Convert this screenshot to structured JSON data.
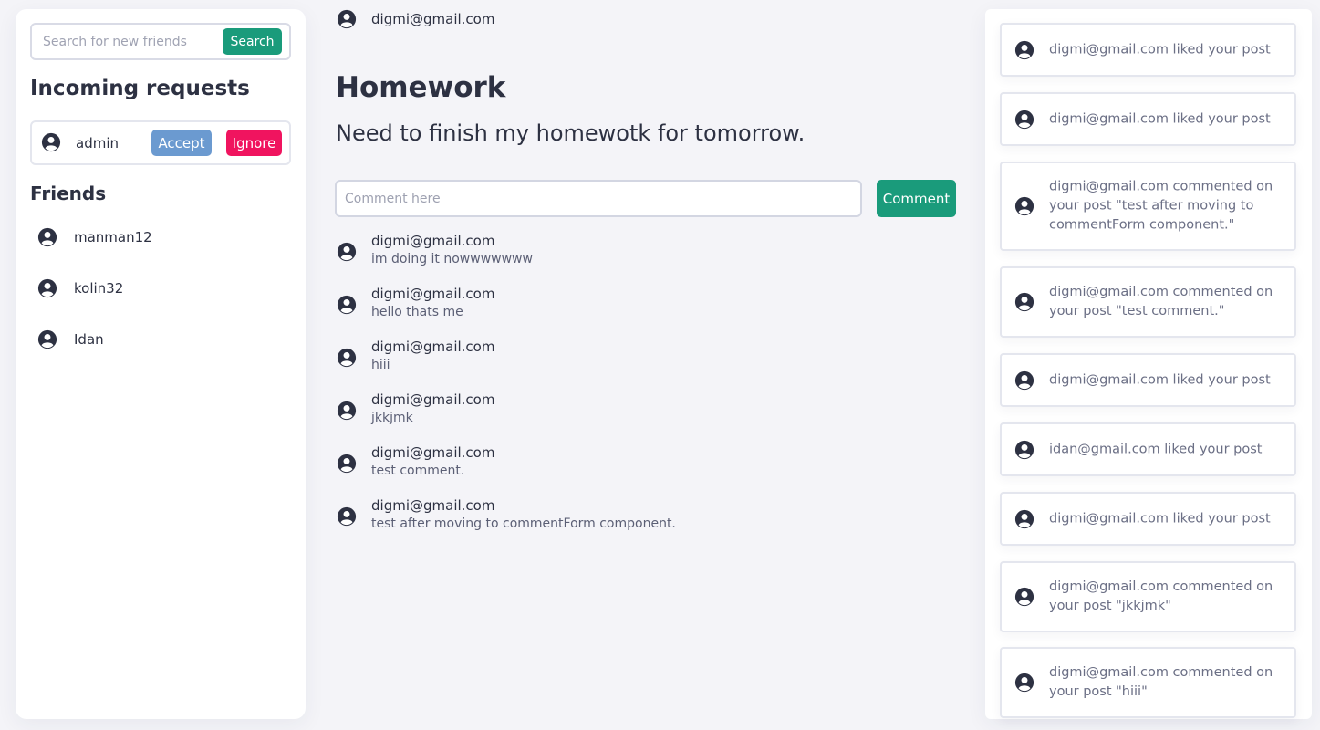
{
  "sidebar": {
    "search": {
      "placeholder": "Search for new friends",
      "button_label": "Search"
    },
    "incoming_title": "Incoming requests",
    "requests": [
      {
        "name": "admin",
        "accept_label": "Accept",
        "ignore_label": "Ignore"
      }
    ],
    "friends_title": "Friends",
    "friends": [
      {
        "name": "manman12"
      },
      {
        "name": "kolin32"
      },
      {
        "name": "Idan"
      }
    ]
  },
  "post": {
    "author": "digmi@gmail.com",
    "title": "Homework",
    "body": "Need to finish my homewotk for tomorrow.",
    "comment_placeholder": "Comment here",
    "comment_button_label": "Comment",
    "comments": [
      {
        "author": "digmi@gmail.com",
        "text": "im doing it nowwwwwww"
      },
      {
        "author": "digmi@gmail.com",
        "text": "hello thats me"
      },
      {
        "author": "digmi@gmail.com",
        "text": "hiii"
      },
      {
        "author": "digmi@gmail.com",
        "text": "jkkjmk"
      },
      {
        "author": "digmi@gmail.com",
        "text": "test comment."
      },
      {
        "author": "digmi@gmail.com",
        "text": "test after moving to commentForm component."
      }
    ]
  },
  "notifications": [
    {
      "text": "digmi@gmail.com liked your post"
    },
    {
      "text": "digmi@gmail.com liked your post"
    },
    {
      "text": "digmi@gmail.com commented on your post \"test after moving to commentForm component.\""
    },
    {
      "text": "digmi@gmail.com commented on your post \"test comment.\""
    },
    {
      "text": "digmi@gmail.com liked your post"
    },
    {
      "text": "idan@gmail.com liked your post"
    },
    {
      "text": "digmi@gmail.com liked your post"
    },
    {
      "text": "digmi@gmail.com commented on your post \"jkkjmk\""
    },
    {
      "text": "digmi@gmail.com commented on your post \"hiii\""
    }
  ],
  "colors": {
    "primary": "#1a9b7b",
    "accept": "#6b9ad0",
    "ignore": "#f0145f",
    "text": "#2d3142",
    "background": "#f4f4f8"
  },
  "icons": {
    "avatar": "user-circle-icon"
  }
}
